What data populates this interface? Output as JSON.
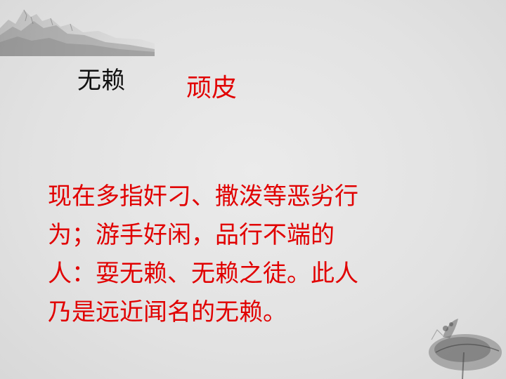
{
  "slide": {
    "term": "无赖",
    "meaning": "顽皮",
    "definition_lines": [
      "现在多指奸刁、撒泼等恶劣行",
      "为；游手好闲，品行不端的",
      "人：耍无赖、无赖之徒。此人",
      "乃是远近闻名的无赖。"
    ]
  },
  "decorations": {
    "top_left": "ink-mountains-icon",
    "bottom_right": "lotus-leaf-icon"
  },
  "colors": {
    "background": "#e4e4e4",
    "term": "#111111",
    "accent_red": "#e10000"
  }
}
